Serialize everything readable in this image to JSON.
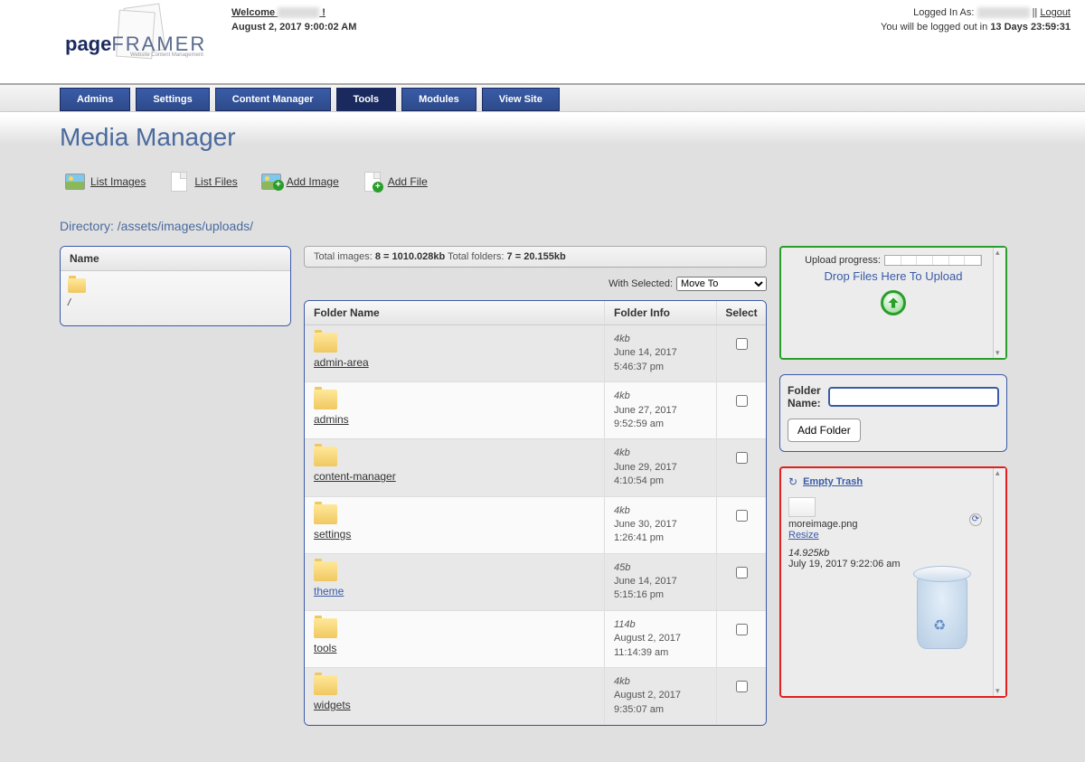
{
  "header": {
    "welcome_prefix": "Welcome",
    "welcome_suffix": "!",
    "date": "August 2, 2017 9:00:02 AM",
    "logged_in_prefix": "Logged In As:",
    "logout": "Logout",
    "timer_prefix": "You will be logged out in",
    "timer_value": "13 Days 23:59:31",
    "logo_main_a": "page",
    "logo_main_b": "FRAMER",
    "logo_sub": "Website Content Management"
  },
  "nav": {
    "items": [
      "Admins",
      "Settings",
      "Content Manager",
      "Tools",
      "Modules",
      "View Site"
    ],
    "active": "Tools"
  },
  "page": {
    "title": "Media Manager",
    "directory_label": "Directory:",
    "directory_path": "/assets/images/uploads/"
  },
  "toolbar": {
    "list_images": "List Images",
    "list_files": "List Files",
    "add_image": "Add Image",
    "add_file": "Add File"
  },
  "left": {
    "header": "Name",
    "root": "/"
  },
  "stats": {
    "total_images_label": "Total images:",
    "total_images_value": "8 = 1010.028kb",
    "total_folders_label": "Total folders:",
    "total_folders_value": "7 = 20.155kb"
  },
  "with_selected": {
    "label": "With Selected:",
    "option": "Move To"
  },
  "table": {
    "col_name": "Folder Name",
    "col_info": "Folder Info",
    "col_select": "Select",
    "rows": [
      {
        "name": "admin-area",
        "size": "4kb",
        "date": "June 14, 2017 5:46:37 pm"
      },
      {
        "name": "admins",
        "size": "4kb",
        "date": "June 27, 2017 9:52:59 am"
      },
      {
        "name": "content-manager",
        "size": "4kb",
        "date": "June 29, 2017 4:10:54 pm"
      },
      {
        "name": "settings",
        "size": "4kb",
        "date": "June 30, 2017 1:26:41 pm"
      },
      {
        "name": "theme",
        "size": "45b",
        "date": "June 14, 2017 5:15:16 pm",
        "blue": true
      },
      {
        "name": "tools",
        "size": "114b",
        "date": "August 2, 2017 11:14:39 am"
      },
      {
        "name": "widgets",
        "size": "4kb",
        "date": "August 2, 2017 9:35:07 am"
      }
    ]
  },
  "upload": {
    "progress_label": "Upload progress:",
    "drop_text": "Drop Files Here To Upload"
  },
  "folder_add": {
    "label": "Folder Name:",
    "button": "Add Folder"
  },
  "trash": {
    "empty": "Empty Trash",
    "item_name": "moreimage.png",
    "resize": "Resize",
    "item_size": "14.925kb",
    "item_date": "July 19, 2017 9:22:06 am"
  }
}
